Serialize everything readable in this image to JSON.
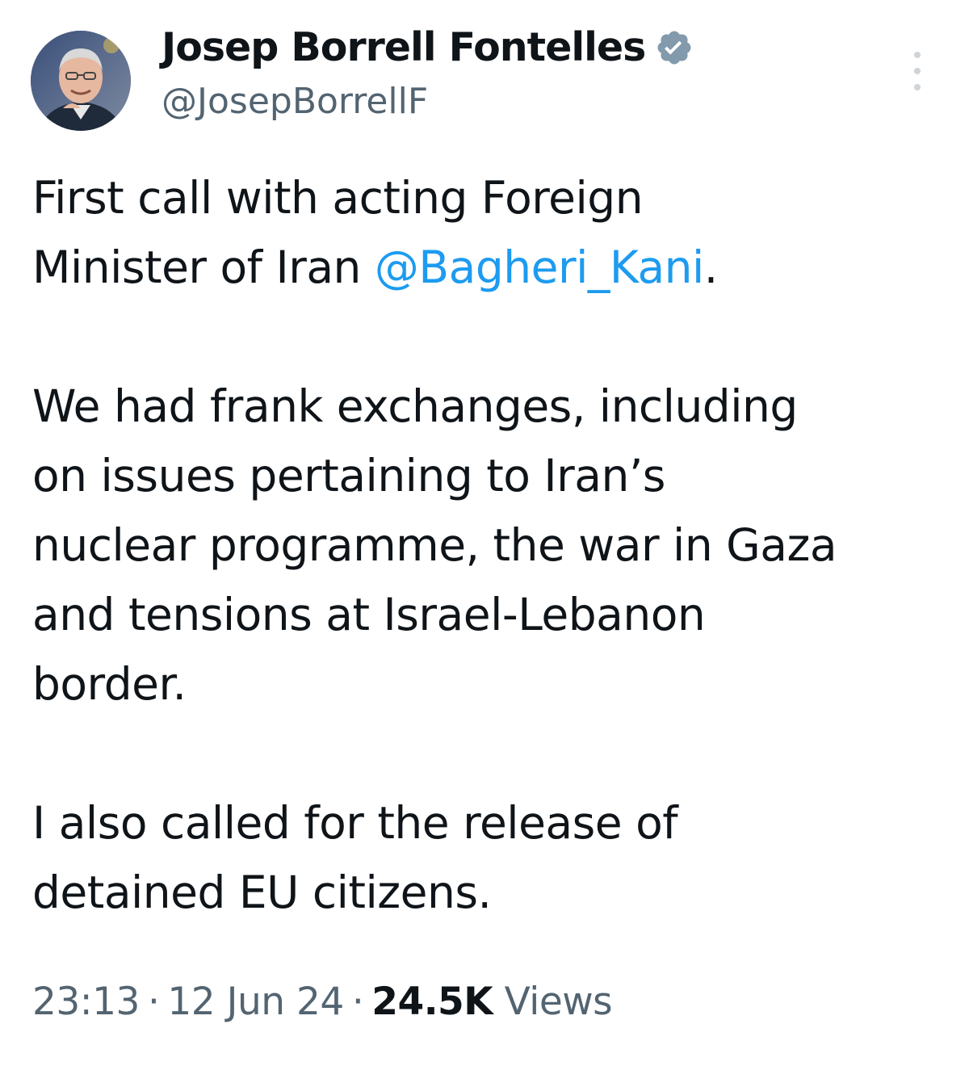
{
  "author": {
    "display_name": "Josep Borrell Fontelles",
    "handle": "@JosepBorrellF",
    "verified": true,
    "avatar_icon": "profile-photo"
  },
  "tweet": {
    "paragraphs": [
      {
        "lines": [
          [
            {
              "text": "First call with acting Foreign"
            }
          ],
          [
            {
              "text": "Minister of Iran "
            },
            {
              "text": "@Bagheri_Kani",
              "mention": true
            },
            {
              "text": "."
            }
          ]
        ]
      },
      {
        "lines": [
          [
            {
              "text": "We had frank exchanges, including"
            }
          ],
          [
            {
              "text": "on issues pertaining to Iran’s"
            }
          ],
          [
            {
              "text": "nuclear programme, the war in Gaza"
            }
          ],
          [
            {
              "text": "and tensions at Israel-Lebanon"
            }
          ],
          [
            {
              "text": "border."
            }
          ]
        ]
      },
      {
        "lines": [
          [
            {
              "text": "I also called for the release of"
            }
          ],
          [
            {
              "text": "detained  EU citizens."
            }
          ]
        ]
      }
    ],
    "time": "23:13",
    "date": "12 Jun 24",
    "views_count": "24.5K",
    "views_label": "Views",
    "separator": "·"
  },
  "colors": {
    "text": "#0f1419",
    "secondary": "#536471",
    "mention": "#1d9bf0",
    "verified_badge": "#829aab"
  },
  "icons": {
    "verified": "verified-badge-icon",
    "more": "more-options-icon"
  }
}
